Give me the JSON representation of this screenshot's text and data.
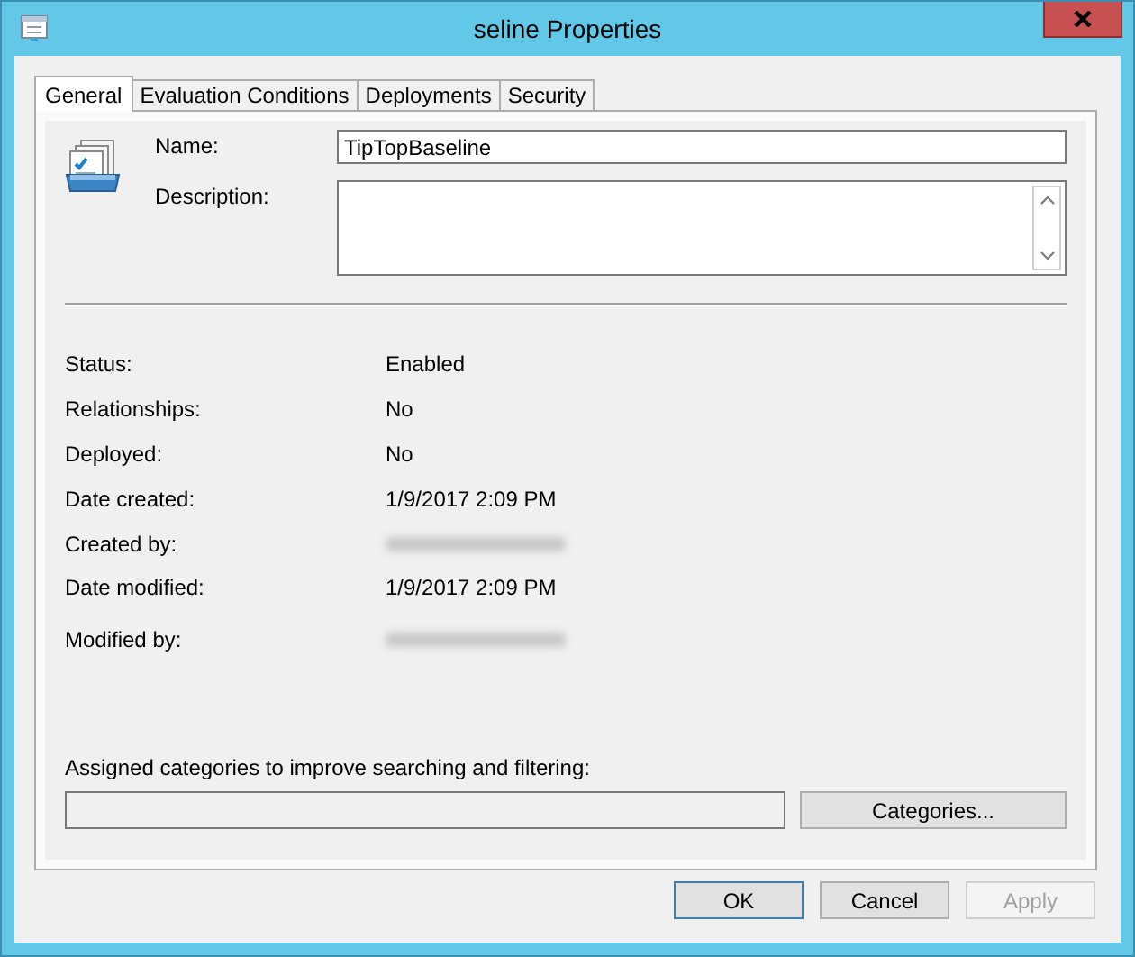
{
  "window": {
    "title": "seline Properties"
  },
  "tabs": [
    {
      "label": "General",
      "selected": true
    },
    {
      "label": "Evaluation Conditions",
      "selected": false
    },
    {
      "label": "Deployments",
      "selected": false
    },
    {
      "label": "Security",
      "selected": false
    }
  ],
  "general": {
    "name_label": "Name:",
    "name_value": "TipTopBaseline",
    "description_label": "Description:",
    "properties": [
      {
        "label": "Status:",
        "kind": "text",
        "value": "Enabled"
      },
      {
        "label": "Relationships:",
        "kind": "text",
        "value": "No"
      },
      {
        "label": "Deployed:",
        "kind": "text",
        "value": "No"
      },
      {
        "label": "Date created:",
        "kind": "text",
        "value": "1/9/2017 2:09 PM"
      },
      {
        "label": "Created by:",
        "kind": "redacted"
      },
      {
        "label": "Date modified:",
        "kind": "text",
        "value": "1/9/2017 2:09 PM"
      },
      {
        "label": "Modified by:",
        "kind": "redacted"
      }
    ],
    "categories_label": "Assigned categories to improve searching and filtering:",
    "categories_button": "Categories..."
  },
  "buttons": [
    {
      "label": "OK",
      "default": true,
      "disabled": false
    },
    {
      "label": "Cancel",
      "default": false,
      "disabled": false
    },
    {
      "label": "Apply",
      "default": false,
      "disabled": true
    }
  ]
}
